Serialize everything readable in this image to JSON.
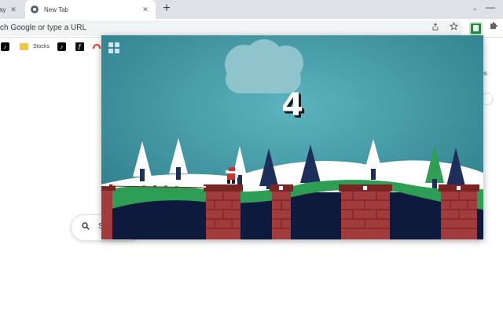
{
  "browser": {
    "tabs": [
      {
        "label": "ay",
        "active": false
      },
      {
        "label": "New Tab",
        "active": true
      }
    ],
    "new_tab_symbol": "+",
    "close_symbol": "✕",
    "tab_search_symbol": "⌄",
    "minimize_symbol": "—",
    "omnibox": {
      "text": "ch Google or type a URL"
    },
    "bookmarks": [
      {
        "label": "",
        "icon": "tiktok-icon"
      },
      {
        "label": "Stocks",
        "icon": "folder-icon"
      },
      {
        "label": "",
        "icon": "tiktok-icon"
      },
      {
        "label": "",
        "icon": "dark-app-icon"
      },
      {
        "label": "",
        "icon": "rainbow-icon"
      }
    ]
  },
  "ntp": {
    "partial_text": "ges",
    "search_placeholder": "S"
  },
  "game": {
    "score": "4",
    "colors": {
      "sky": "#3a8f99",
      "snow": "#ffffff",
      "grass": "#2e9e54",
      "ground": "#0e1a3d",
      "brick": "#a23b3b",
      "brick_dark": "#7a2424",
      "tree_light": "#ffffff",
      "tree_dark": "#1e2e5a"
    }
  }
}
